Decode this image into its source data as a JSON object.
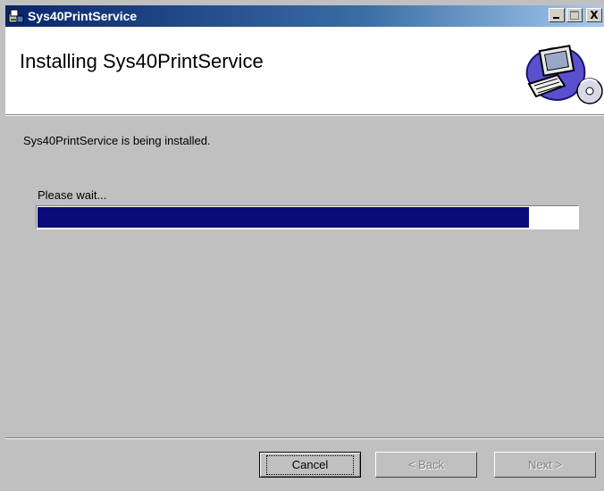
{
  "window": {
    "title": "Sys40PrintService",
    "controls": {
      "minimize": "_",
      "maximize": "□",
      "close": "X"
    }
  },
  "banner": {
    "title": "Installing Sys40PrintService",
    "icon": "computer-cd-icon"
  },
  "main": {
    "status": "Sys40PrintService is being installed.",
    "wait_label": "Please wait...",
    "progress_percent": 91
  },
  "footer": {
    "cancel_label": "Cancel",
    "back_label": "< Back",
    "next_label": "Next >"
  },
  "colors": {
    "titlebar_start": "#0a246a",
    "dialog_bg": "#c0c0c0",
    "progress_fill": "#0a0a7a"
  }
}
